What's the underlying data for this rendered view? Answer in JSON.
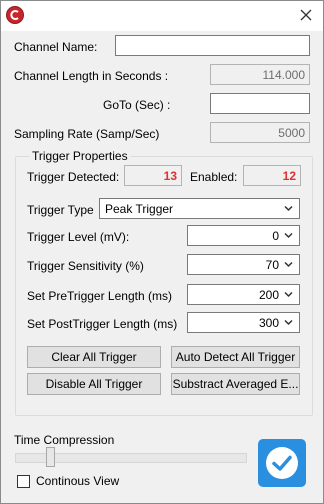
{
  "window": {
    "close_glyph": "✕"
  },
  "form": {
    "channel_name_label": "Channel Name:",
    "channel_name_value": "",
    "channel_length_label": "Channel Length in Seconds :",
    "channel_length_value": "114.000",
    "goto_label": "GoTo (Sec) :",
    "goto_value": "",
    "sampling_rate_label": "Sampling Rate (Samp/Sec)",
    "sampling_rate_value": "5000"
  },
  "trigger": {
    "group_title": "Trigger Properties",
    "detected_label": "Trigger Detected:",
    "detected_value": "13",
    "enabled_label": "Enabled:",
    "enabled_value": "12",
    "type_label": "Trigger Type",
    "type_value": "Peak Trigger",
    "level_label": "Trigger Level (mV):",
    "level_value": "0",
    "sensitivity_label": "Trigger Sensitivity (%)",
    "sensitivity_value": "70",
    "pre_label": "Set PreTrigger Length (ms)",
    "pre_value": "200",
    "post_label": "Set PostTrigger Length (ms)",
    "post_value": "300",
    "buttons": {
      "clear_all": "Clear All Trigger",
      "auto_detect": "Auto Detect All Trigger",
      "disable_all": "Disable All Trigger",
      "subtract_avg": "Substract Averaged E..."
    }
  },
  "footer": {
    "time_compression_label": "Time Compression",
    "time_compression_level": 0.15,
    "continuous_view_label": "Continous View",
    "continuous_view_checked": false
  },
  "colors": {
    "accent": "#2b8fe0",
    "alert_red": "#e0302f",
    "app_icon": "#c8262e"
  },
  "icons": {
    "app": "app-logo-icon",
    "close": "close-icon",
    "dropdown": "chevron-down-icon",
    "ok": "checkmark-icon"
  }
}
